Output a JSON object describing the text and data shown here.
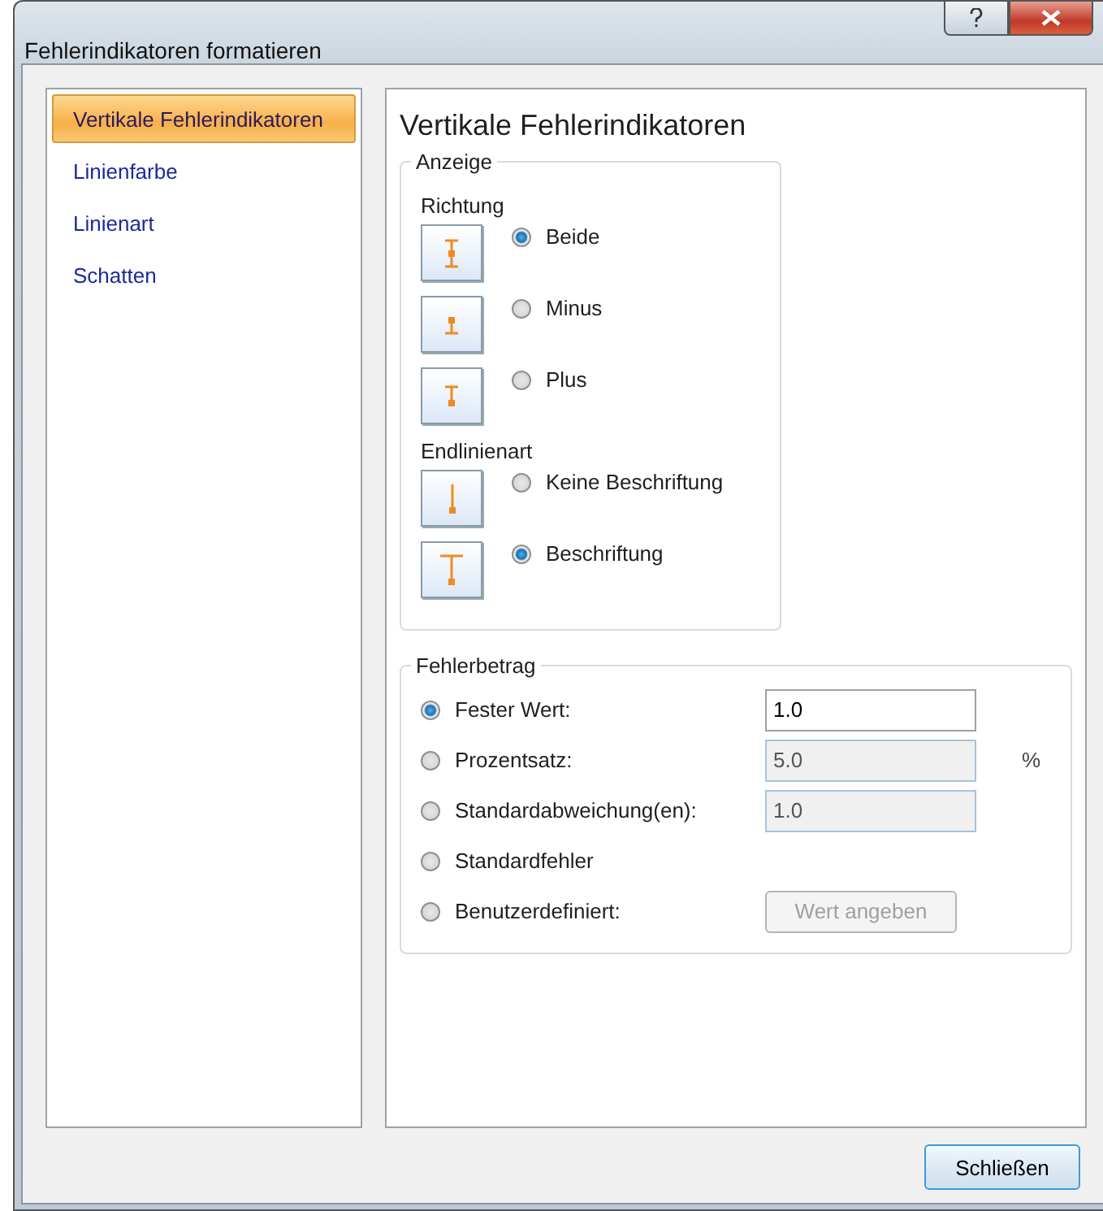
{
  "window": {
    "title": "Fehlerindikatoren formatieren"
  },
  "sidebar": {
    "items": [
      {
        "label": "Vertikale Fehlerindikatoren",
        "selected": true
      },
      {
        "label": "Linienfarbe",
        "selected": false
      },
      {
        "label": "Linienart",
        "selected": false
      },
      {
        "label": "Schatten",
        "selected": false
      }
    ]
  },
  "panel": {
    "heading": "Vertikale Fehlerindikatoren",
    "display_group": {
      "title": "Anzeige",
      "sections": [
        {
          "label": "Richtung",
          "options": [
            {
              "label": "Beide",
              "kind": "both",
              "selected": true
            },
            {
              "label": "Minus",
              "kind": "minus",
              "selected": false
            },
            {
              "label": "Plus",
              "kind": "plus",
              "selected": false
            }
          ]
        },
        {
          "label": "Endlinienart",
          "options": [
            {
              "label": "Keine Beschriftung",
              "kind": "nocap",
              "selected": false
            },
            {
              "label": "Beschriftung",
              "kind": "cap",
              "selected": true
            }
          ]
        }
      ]
    },
    "amount_group": {
      "title": "Fehlerbetrag",
      "options": [
        {
          "label": "Fester Wert:",
          "kind": "input",
          "value": "1.0",
          "disabled": false,
          "selected": true
        },
        {
          "label": "Prozentsatz:",
          "kind": "input",
          "value": "5.0",
          "disabled": true,
          "unit": "%",
          "selected": false
        },
        {
          "label": "Standardabweichung(en):",
          "kind": "input",
          "value": "1.0",
          "disabled": true,
          "selected": false
        },
        {
          "label": "Standardfehler",
          "kind": "plain",
          "selected": false
        },
        {
          "label": "Benutzerdefiniert:",
          "kind": "button",
          "button": "Wert angeben",
          "disabled": true,
          "selected": false
        }
      ]
    }
  },
  "footer": {
    "close_button": "Schließen"
  }
}
